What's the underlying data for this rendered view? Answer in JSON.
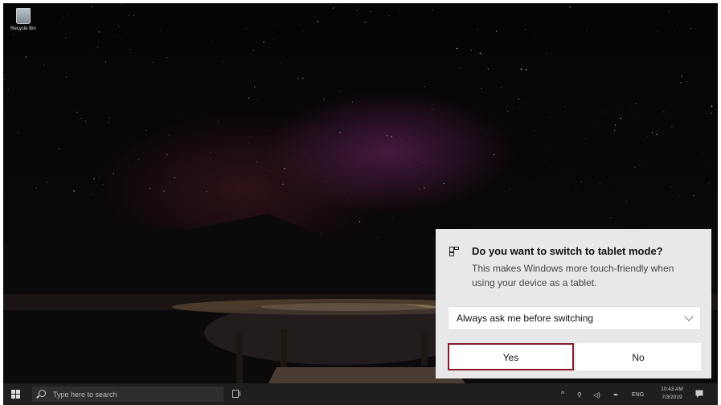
{
  "desktop": {
    "recycle_bin_label": "Recycle Bin"
  },
  "notification": {
    "icon": "tablet-mode-icon",
    "title": "Do you want to switch to tablet mode?",
    "body": "This makes Windows more touch-friendly when using your device as a tablet.",
    "select_value": "Always ask me before switching",
    "yes_label": "Yes",
    "no_label": "No",
    "accent_color": "#8b1a2b"
  },
  "taskbar": {
    "search_placeholder": "Type here to search",
    "language": "ENG",
    "time": "10:43 AM",
    "date": "7/3/2019"
  }
}
